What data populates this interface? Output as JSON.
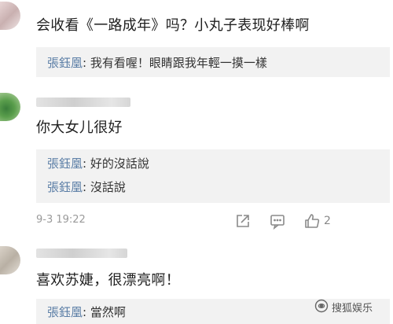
{
  "comments": [
    {
      "text": "会收看《一路成年》吗？小丸子表现好棒啊",
      "replies": [
        {
          "name": "張鈺凰",
          "text": "我有看喔！眼睛跟我年輕一摸一樣"
        }
      ]
    },
    {
      "text": "你大女儿很好",
      "replies": [
        {
          "name": "張鈺凰",
          "text": "好的沒話說"
        },
        {
          "name": "張鈺凰",
          "text": "沒話說"
        }
      ],
      "timestamp": "9-3 19:22",
      "like_count": "2"
    },
    {
      "text": "喜欢苏婕，很漂亮啊！",
      "replies": [
        {
          "name": "張鈺凰",
          "text": "當然啊"
        }
      ]
    }
  ],
  "reply_separator": ": ",
  "icons": {
    "share": "share-icon",
    "comment": "comment-icon",
    "like": "thumbs-up-icon",
    "watermark": "sohu-logo-icon"
  },
  "watermark": {
    "text": "搜狐娱乐"
  },
  "colors": {
    "reply_name": "#5b7ea6",
    "reply_bg": "#f2f2f2",
    "meta_text": "#9a9a9a"
  }
}
